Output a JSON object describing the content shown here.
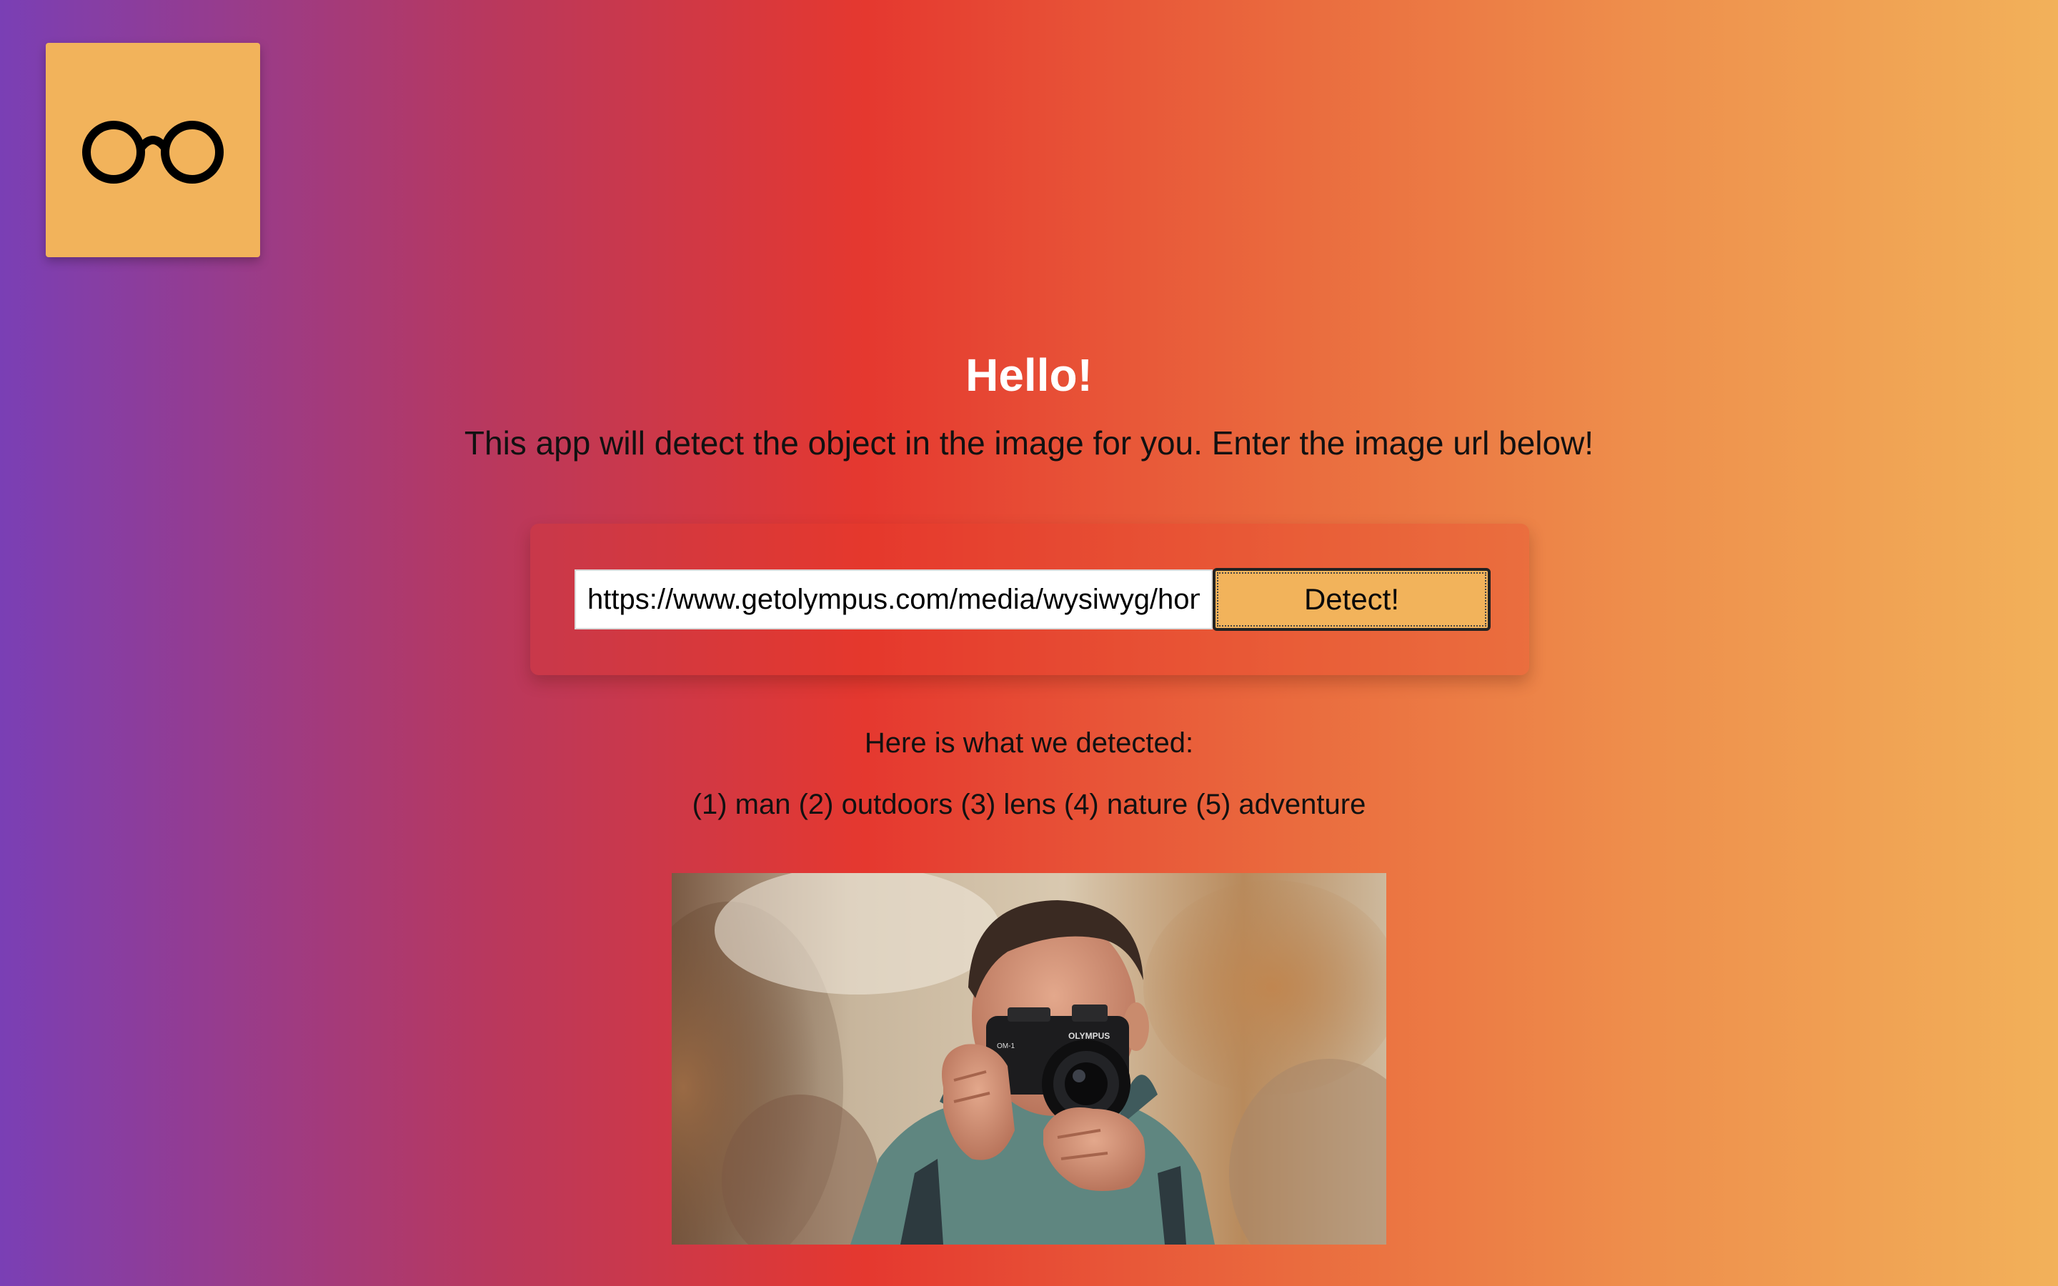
{
  "logo": {
    "icon": "glasses-icon",
    "color": "#f2b35b"
  },
  "hero": {
    "title": "Hello!",
    "subtitle": "This app will detect the object in the image for you. Enter the image url below!"
  },
  "form": {
    "url_value": "https://www.getolympus.com/media/wysiwyg/hon",
    "detect_label": "Detect!"
  },
  "results": {
    "heading": "Here is what we detected:",
    "items": "(1) man (2) outdoors (3) lens (4) nature (5) adventure"
  },
  "photo": {
    "camera_brand": "OLYMPUS",
    "camera_model": "OM-1"
  },
  "colors": {
    "accent": "#f2b35b",
    "gradient": [
      "#7a3fb5",
      "#e5382f",
      "#f2b15a"
    ]
  }
}
